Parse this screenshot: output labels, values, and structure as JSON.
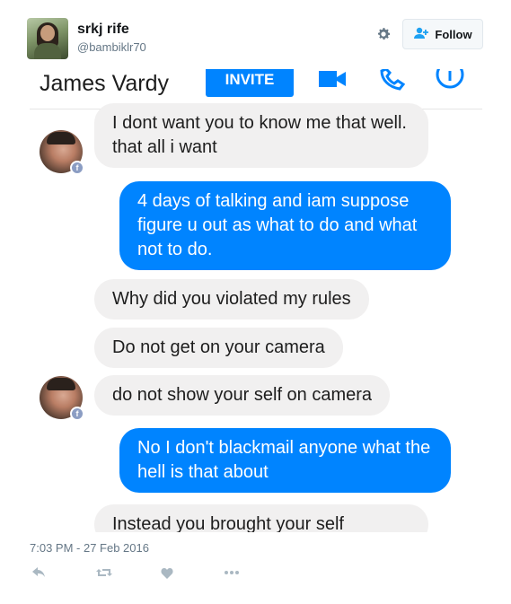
{
  "tweet": {
    "author": {
      "name": "srkj rife",
      "handle": "@bambiklr70"
    },
    "follow_label": "Follow",
    "timestamp": "7:03 PM - 27 Feb 2016",
    "actions": [
      "reply-icon",
      "retweet-icon",
      "like-icon",
      "more-icon"
    ]
  },
  "screenshot": {
    "contact_name": "James Vardy",
    "invite_label": "INVITE",
    "icons": [
      "video-camera-icon",
      "phone-icon",
      "info-icon"
    ],
    "messages": [
      {
        "direction": "in",
        "text": "I dont want you to know me that well. that all i want"
      },
      {
        "direction": "out",
        "text": "4 days of talking and iam suppose figure u out as what to do and what not to do."
      },
      {
        "direction": "in",
        "text": "Why did you violated my rules"
      },
      {
        "direction": "in",
        "text": "Do not get on your camera"
      },
      {
        "direction": "in",
        "text": "do not show your self on camera"
      },
      {
        "direction": "out",
        "text": "No I don't blackmail anyone what the hell is that about"
      },
      {
        "direction": "in",
        "text": "Instead you brought your self"
      }
    ]
  },
  "colors": {
    "outgoing_bubble": "#0084ff",
    "incoming_bubble": "#f1f0f0",
    "twitter_secondary_text": "#657786"
  }
}
